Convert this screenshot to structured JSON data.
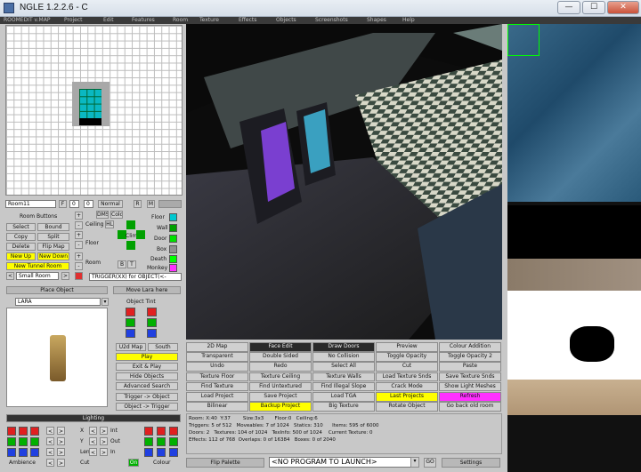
{
  "window": {
    "title": "NGLE 1.2.2.6 - C",
    "min_glyph": "—",
    "max_glyph": "☐",
    "close_glyph": "✕"
  },
  "menu": [
    "ROOMEDIT v.MAP",
    "Project",
    "Edit",
    "Features",
    "Room",
    "Texture",
    "Effects",
    "Objects",
    "Screenshots",
    "Shapes",
    "Help"
  ],
  "room": {
    "name": "Room11",
    "flag_f": "F",
    "val_0": "0",
    "val_0b": "0",
    "normal": "Normal",
    "r": "R",
    "m": "M",
    "dms": "DMS",
    "cold": "Cold",
    "ceiling": "Ceiling",
    "hl": "HL",
    "climb": "Climb",
    "floor": "Floor",
    "room": "Room",
    "b": "B",
    "t": "T",
    "trigger_combo": "TRIGGER(XX) for OBJECT(<-",
    "room_buttons_label": "Room Buttons"
  },
  "room_buttons": {
    "select": "Select",
    "bound": "Bound",
    "copy": "Copy",
    "split": "Split",
    "delete": "Delete",
    "flip_map": "Flip Map",
    "new_up": "New Up",
    "new_down": "New Down",
    "new_tunnel_room": "New Tunnel Room",
    "small_room": "Small Room"
  },
  "plus": "+",
  "minus": "-",
  "flags": [
    {
      "label": "Floor",
      "color": "#00c8d0"
    },
    {
      "label": "Wall",
      "color": "#00a000"
    },
    {
      "label": "Door",
      "color": "#00e000"
    },
    {
      "label": "Box",
      "color": "#909090"
    },
    {
      "label": "Death",
      "color": "#00ff00"
    },
    {
      "label": "Monkey",
      "color": "#ff30ff"
    }
  ],
  "objects": {
    "place_object": "Place Object",
    "move_lara_here": "Move Lara here",
    "selected": "LARA",
    "object_tint": "Object Tint",
    "u2d_map": "U2d Map",
    "south": "South",
    "play": "Play",
    "exit_play": "Exit & Play",
    "hide_objects": "Hide Objects",
    "advanced_search": "Advanced Search",
    "trigger_object": "Trigger -> Object",
    "object_trigger": "Object -> Trigger"
  },
  "lighting": {
    "title": "Lighting",
    "x": "X",
    "y": "Y",
    "len": "Len",
    "cut": "Cut",
    "int": "Int",
    "out": "Out",
    "in": "In",
    "ambience": "Ambience",
    "on": "On",
    "colour": "Colour",
    "left_arrow": "<",
    "right_arrow": ">"
  },
  "toolbar": [
    [
      "2D Map",
      "Face Edit",
      "Draw Doors",
      "Preview",
      "Colour Addition"
    ],
    [
      "Transparent",
      "Double Sided",
      "No Collision",
      "Toggle Opacity",
      "Toggle Opacity 2"
    ],
    [
      "Undo",
      "Redo",
      "Select All",
      "Cut",
      "Paste"
    ],
    [
      "Texture Floor",
      "Texture Ceiling",
      "Texture Walls",
      "Load Texture Snds",
      "Save Texture Snds"
    ],
    [
      "Find Texture",
      "Find Untextured",
      "Find Illegal Slope",
      "Crack Mode",
      "Show Light Meshes"
    ],
    [
      "Load Project",
      "Save Project",
      "Load TGA",
      "Last Projects",
      "Refresh"
    ],
    [
      "Bilinear",
      "Backup Project",
      "Big Texture",
      "Rotate Object",
      "Go back old room"
    ]
  ],
  "status": {
    "line1": "Room: X:40  Y:37        Size:3x3       Floor:0   Ceiling:6",
    "line2": "Triggers: 5 of 512   Moveables: 7 of 1024   Statics: 310      Items: 595 of 6000",
    "line3": "Doors: 2   Textures: 104 of 1024   TexInfo: 500 of 1024    Current Texture: 0",
    "line4": "Effects: 112 of 768  Overlaps: 0 of 16384   Boxes: 0 of 2040"
  },
  "bottom": {
    "flip_palette": "Flip Palette",
    "program": "<NO PROGRAM TO LAUNCH>",
    "go": "GO",
    "settings": "Settings"
  },
  "colors": {
    "yellow": "#ffff00",
    "magenta": "#ff30ff",
    "dark": "#2a2a2a",
    "floor_cyan": "#0ab8c2"
  }
}
